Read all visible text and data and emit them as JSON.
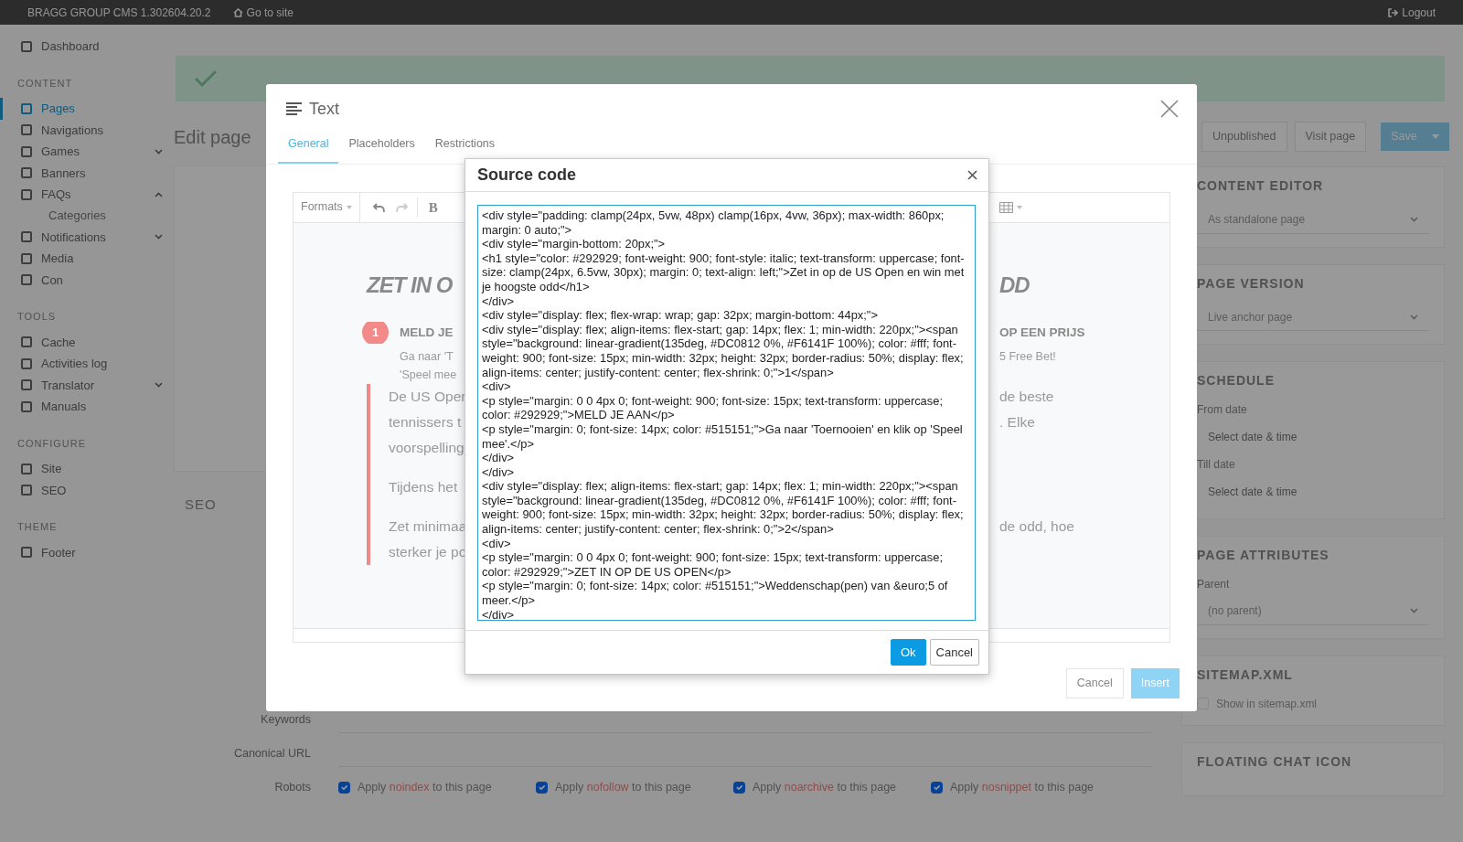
{
  "top_bar": {
    "brand": "BRAGG GROUP CMS 1.302604.20.2",
    "go_to_site": "Go to site",
    "logout": "Logout"
  },
  "sidebar": {
    "items": [
      {
        "kind": "item",
        "label": "Dashboard",
        "selected": false
      },
      {
        "kind": "heading",
        "label": "CONTENT"
      },
      {
        "kind": "item",
        "label": "Pages",
        "selected": true
      },
      {
        "kind": "item",
        "label": "Navigations",
        "selected": false
      },
      {
        "kind": "item",
        "label": "Games",
        "selected": false,
        "expanded": false
      },
      {
        "kind": "item",
        "label": "Banners",
        "selected": false
      },
      {
        "kind": "item",
        "label": "FAQs",
        "selected": false,
        "expanded": true
      },
      {
        "kind": "subitem",
        "label": "Categories",
        "selected": false
      },
      {
        "kind": "item",
        "label": "Notifications",
        "selected": false,
        "expanded": false
      },
      {
        "kind": "item",
        "label": "Media",
        "selected": false
      },
      {
        "kind": "item",
        "label": "Con",
        "selected": false
      },
      {
        "kind": "heading",
        "label": "TOOLS"
      },
      {
        "kind": "item",
        "label": "Cache",
        "selected": false
      },
      {
        "kind": "item",
        "label": "Activities log",
        "selected": false
      },
      {
        "kind": "item",
        "label": "Translator",
        "selected": false,
        "expanded": false
      },
      {
        "kind": "item",
        "label": "Manuals",
        "selected": false
      },
      {
        "kind": "heading",
        "label": "CONFIGURE"
      },
      {
        "kind": "item",
        "label": "Site",
        "selected": false
      },
      {
        "kind": "item",
        "label": "SEO",
        "selected": false
      },
      {
        "kind": "heading",
        "label": "THEME"
      },
      {
        "kind": "item",
        "label": "Footer",
        "selected": false
      }
    ]
  },
  "page": {
    "title": "Edit page",
    "actions": [
      "Unpublished",
      "Visit page"
    ],
    "save_button": "Save",
    "seo_heading": "SEO",
    "seo_fields": [
      {
        "label": "Keywords"
      },
      {
        "label": "Canonical URL"
      }
    ],
    "robots": {
      "label": "Robots",
      "options": [
        {
          "before": "Apply",
          "keyword": "noindex",
          "after": "to this page",
          "checked": true
        },
        {
          "before": "Apply",
          "keyword": "nofollow",
          "after": "to this page",
          "checked": true
        },
        {
          "before": "Apply",
          "keyword": "noarchive",
          "after": "to this page",
          "checked": true
        },
        {
          "before": "Apply",
          "keyword": "nosnippet",
          "after": "to this page",
          "checked": true
        }
      ]
    }
  },
  "side_cards": [
    {
      "heading": "CONTENT EDITOR",
      "fields": [
        {
          "kind": "select",
          "value": "As standalone page"
        }
      ]
    },
    {
      "heading": "PAGE VERSION",
      "fields": [
        {
          "kind": "select",
          "value": "Live anchor page"
        }
      ]
    },
    {
      "heading": "SCHEDULE",
      "fields": [
        {
          "kind": "date",
          "label": "From date",
          "placeholder": "Select date & time"
        },
        {
          "kind": "date",
          "label": "Till date",
          "placeholder": "Select date & time"
        }
      ]
    },
    {
      "heading": "PAGE ATTRIBUTES",
      "fields": [
        {
          "kind": "select",
          "label": "Parent",
          "value": "(no parent)"
        }
      ]
    },
    {
      "heading": "SITEMAP.XML",
      "fields": [
        {
          "kind": "checkbox",
          "label": "Show in sitemap.xml",
          "checked": false
        }
      ]
    },
    {
      "heading": "FLOATING CHAT ICON"
    }
  ],
  "text_modal": {
    "title": "Text",
    "tabs": [
      {
        "label": "General",
        "selected": true
      },
      {
        "label": "Placeholders",
        "selected": false
      },
      {
        "label": "Restrictions",
        "selected": false
      }
    ],
    "toolbar": {
      "formats": "Formats",
      "bold": "B"
    },
    "content_rows": [
      {
        "kind": "title",
        "left": "ZET IN O",
        "right": "DD"
      },
      {
        "kind": "step",
        "badge": "1",
        "left": "MELD JE",
        "right": "OP EEN PRIJS"
      },
      {
        "kind": "sub",
        "left": "Ga naar 'T",
        "right": "5 Free Bet!"
      },
      {
        "kind": "sub",
        "left": "'Speel mee",
        "right": ""
      },
      {
        "kind": "quote",
        "left": "De US Oper",
        "right": "de beste"
      },
      {
        "kind": "quote",
        "left": "tennissers t",
        "right": ". Elke"
      },
      {
        "kind": "quote",
        "left": "voorspelling",
        "right": ""
      },
      {
        "kind": "quote_gap",
        "left": "Tijdens het",
        "right": ""
      },
      {
        "kind": "quote_gap",
        "left": "Zet minimaa",
        "right": "de odd, hoe"
      },
      {
        "kind": "quote",
        "left": "sterker je po",
        "right": ""
      }
    ],
    "buttons": [
      "Cancel",
      "Insert"
    ]
  },
  "source_dialog": {
    "title": "Source code",
    "code": "<div style=\"padding: clamp(24px, 5vw, 48px) clamp(16px, 4vw, 36px); max-width: 860px; margin: 0 auto;\">\n<div style=\"margin-bottom: 20px;\">\n<h1 style=\"color: #292929; font-weight: 900; font-style: italic; text-transform: uppercase; font-size: clamp(24px, 6.5vw, 30px); margin: 0; text-align: left;\">Zet in op de US Open en win met je hoogste odd</h1>\n</div>\n<div style=\"display: flex; flex-wrap: wrap; gap: 32px; margin-bottom: 44px;\">\n<div style=\"display: flex; align-items: flex-start; gap: 14px; flex: 1; min-width: 220px;\"><span style=\"background: linear-gradient(135deg, #DC0812 0%, #F6141F 100%); color: #fff; font-weight: 900; font-size: 15px; min-width: 32px; height: 32px; border-radius: 50%; display: flex; align-items: center; justify-content: center; flex-shrink: 0;\">1</span>\n<div>\n<p style=\"margin: 0 0 4px 0; font-weight: 900; font-size: 15px; text-transform: uppercase; color: #292929;\">MELD JE AAN</p>\n<p style=\"margin: 0; font-size: 14px; color: #515151;\">Ga naar 'Toernooien' en klik op 'Speel mee'.</p>\n</div>\n</div>\n<div style=\"display: flex; align-items: flex-start; gap: 14px; flex: 1; min-width: 220px;\"><span style=\"background: linear-gradient(135deg, #DC0812 0%, #F6141F 100%); color: #fff; font-weight: 900; font-size: 15px; min-width: 32px; height: 32px; border-radius: 50%; display: flex; align-items: center; justify-content: center; flex-shrink: 0;\">2</span>\n<div>\n<p style=\"margin: 0 0 4px 0; font-weight: 900; font-size: 15px; text-transform: uppercase; color: #292929;\">ZET IN OP DE US OPEN</p>\n<p style=\"margin: 0; font-size: 14px; color: #515151;\">Weddenschap(pen) van &euro;5 of meer.</p>\n</div>",
    "buttons": [
      "Ok",
      "Cancel"
    ]
  }
}
